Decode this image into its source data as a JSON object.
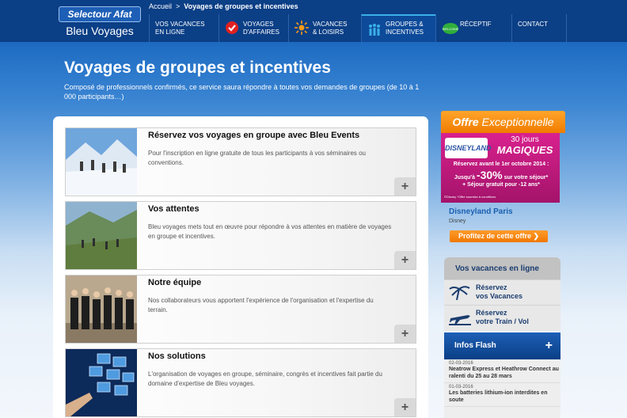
{
  "header": {
    "logo": {
      "brand": "Selectour Afat",
      "sub": "Bleu Voyages"
    },
    "breadcrumb": {
      "home": "Accueil",
      "separator": ">",
      "current": "Voyages de groupes et incentives"
    },
    "nav": [
      {
        "line1": "VOS VACANCES",
        "line2": "EN LIGNE",
        "icon": "none"
      },
      {
        "line1": "VOYAGES",
        "line2": "D'AFFAIRES",
        "icon": "checkmark-icon"
      },
      {
        "line1": "VACANCES",
        "line2": "& LOISIRS",
        "icon": "sun-icon"
      },
      {
        "line1": "GROUPES &",
        "line2": "INCENTIVES",
        "icon": "group-icon"
      },
      {
        "line1": "RÉCEPTIF",
        "line2": "",
        "icon": "welcome-icon"
      },
      {
        "line1": "CONTACT",
        "line2": "",
        "icon": "none"
      }
    ]
  },
  "main": {
    "title": "Voyages de groupes et incentives",
    "intro": "Composé de professionnels confirmés, ce service saura répondre à toutes vos demandes de groupes (de 10 à 1 000 participants…)",
    "cards": [
      {
        "title": "Réservez vos voyages en groupe avec Bleu Events",
        "text": "Pour l'inscription en ligne gratuite de tous les participants à vos séminaires ou conventions.",
        "plus": "+"
      },
      {
        "title": "Vos attentes",
        "text": "Bleu voyages mets tout en œuvre pour répondre à vos attentes en matière de voyages en groupe et incentives.",
        "plus": "+"
      },
      {
        "title": "Notre équipe",
        "text": "Nos collaborateurs vous apportent l'expérience de l'organisation et l'expertise du terrain.",
        "plus": "+"
      },
      {
        "title": "Nos solutions",
        "text": "L'organisation de voyages en groupe, séminaire, congrès et incentives fait partie du domaine d'expertise de Bleu voyages.",
        "plus": "+"
      }
    ]
  },
  "sidebar": {
    "offer": {
      "header_plain": "Offre",
      "header_em": "Exceptionnelle",
      "ad": {
        "logo": "DISNEYLAND",
        "days": "30 jours",
        "magic": "MAGIQUES",
        "reserve": "Réservez avant le 1er octobre 2014 :",
        "pct_prefix": "Jusqu'à",
        "pct": "-30%",
        "pct_suffix": "sur votre séjour*",
        "free": "+ Séjour gratuit pour -12 ans*",
        "legal": "©Disney *Offre soumise à conditions"
      },
      "name": "Disneyland Paris",
      "subtitle": "Disney",
      "cta": "Profitez de cette offre ❯"
    },
    "vacances": {
      "title": "Vos vacances en ligne",
      "links": [
        {
          "line1": "Réservez",
          "line2": "vos Vacances",
          "icon": "palm-tree-icon"
        },
        {
          "line1": "Réservez",
          "line2": "votre Train / Vol",
          "icon": "plane-icon"
        }
      ]
    },
    "flash": {
      "title": "Infos Flash",
      "plus": "+",
      "items": [
        {
          "date": "02-03-2016",
          "text": "Neatrow Express et Heathrow Connect au ralenti du 25 au 28 mars"
        },
        {
          "date": "01-03-2016",
          "text": "Les batteries lithium-ion interdites en soute"
        }
      ]
    }
  }
}
